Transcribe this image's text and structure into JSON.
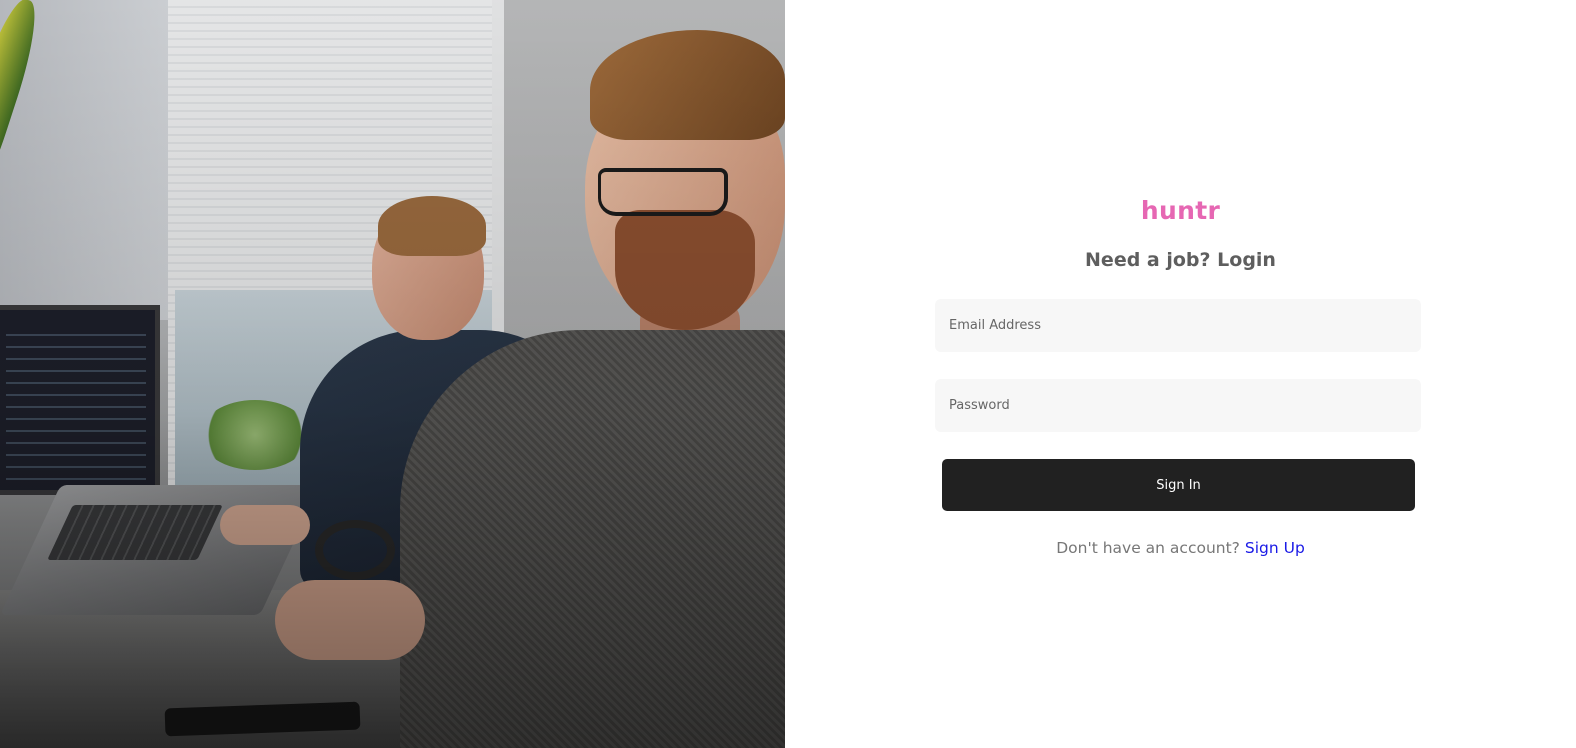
{
  "brand": {
    "name": "huntr",
    "color": "#e667b3"
  },
  "login": {
    "heading": "Need a job? Login",
    "email_placeholder": "Email Address",
    "email_value": "",
    "password_placeholder": "Password",
    "password_value": "",
    "signin_label": "Sign In",
    "no_account_text": "Don't have an account?",
    "signup_link": "Sign Up"
  },
  "colors": {
    "button_bg": "#212121",
    "field_bg": "#f7f7f7",
    "link": "#1a1ae6",
    "heading": "#5e5e5e"
  }
}
